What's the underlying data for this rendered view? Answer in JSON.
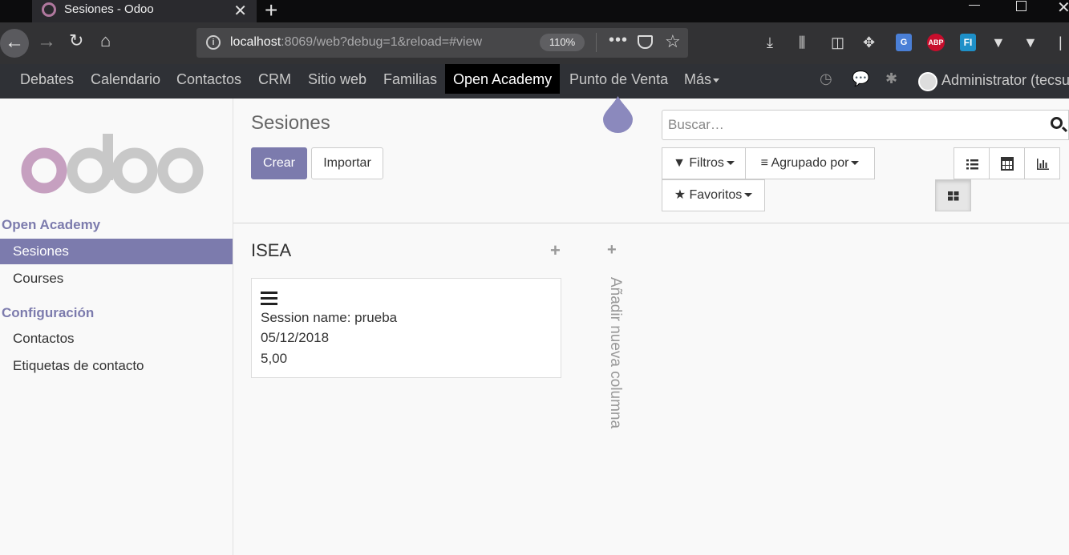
{
  "browser": {
    "tab_title": "Sesiones - Odoo",
    "url_host": "localhost",
    "url_rest": ":8069/web?debug=1&reload=#view",
    "zoom": "110%",
    "ext_abp": "ABP",
    "ext_fi": "FI",
    "ext_gt": "G"
  },
  "topmenu": {
    "items": [
      "Debates",
      "Calendario",
      "Contactos",
      "CRM",
      "Sitio web",
      "Familias",
      "Open Academy",
      "Punto de Venta",
      "Más"
    ],
    "active": "Open Academy",
    "user": "Administrator (tecsup)"
  },
  "sidebar": {
    "section1": "Open Academy",
    "items1": [
      "Sesiones",
      "Courses"
    ],
    "section2": "Configuración",
    "items2": [
      "Contactos",
      "Etiquetas de contacto"
    ]
  },
  "control_panel": {
    "breadcrumb": "Sesiones",
    "create_label": "Crear",
    "import_label": "Importar",
    "search_placeholder": "Buscar…",
    "filters_label": "Filtros",
    "groupby_label": "Agrupado por",
    "favorites_label": "Favoritos"
  },
  "kanban": {
    "column_title": "ISEA",
    "add_column_label": "Añadir nueva columna",
    "card": {
      "session_name": "Session name: prueba",
      "date": "05/12/2018",
      "value": "5,00"
    }
  },
  "colors": {
    "brand": "#7c7bad",
    "menu_bg": "#2f3136",
    "browser_bg": "#323234"
  }
}
